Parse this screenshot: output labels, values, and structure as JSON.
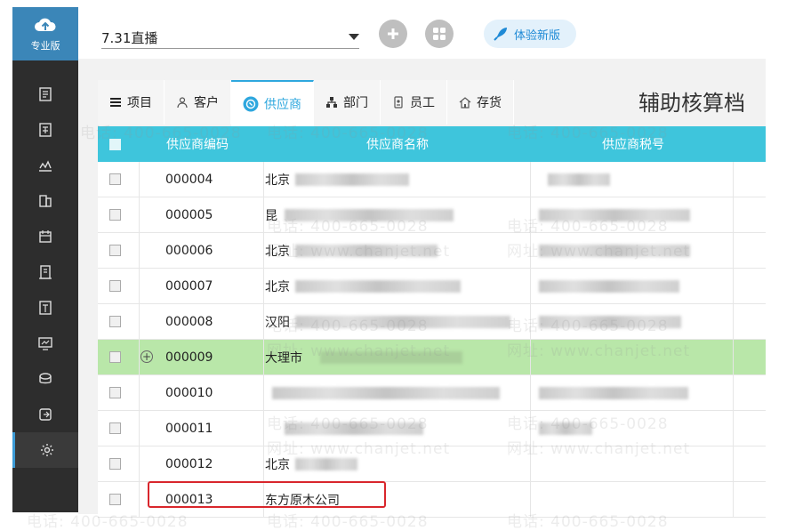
{
  "sidebar": {
    "edition": "专业版",
    "items": [
      {
        "icon": "voucher-icon"
      },
      {
        "icon": "ledger-icon"
      },
      {
        "icon": "chart-line-icon"
      },
      {
        "icon": "report-icon"
      },
      {
        "icon": "calendar-icon"
      },
      {
        "icon": "document-icon"
      },
      {
        "icon": "invoice-icon"
      },
      {
        "icon": "screen-icon"
      },
      {
        "icon": "coins-icon"
      },
      {
        "icon": "export-icon"
      },
      {
        "icon": "gear-icon"
      }
    ]
  },
  "header": {
    "period_value": "7.31直播",
    "new_version_label": "体验新版"
  },
  "tabs": [
    {
      "label": "项目",
      "icon": "list-icon"
    },
    {
      "label": "客户",
      "icon": "user-icon"
    },
    {
      "label": "供应商",
      "icon": "supplier-icon",
      "active": true
    },
    {
      "label": "部门",
      "icon": "org-icon"
    },
    {
      "label": "员工",
      "icon": "badge-icon"
    },
    {
      "label": "存货",
      "icon": "house-icon"
    }
  ],
  "page_title": "辅助核算档",
  "table": {
    "columns": [
      "供应商编码",
      "供应商名称",
      "供应商税号"
    ],
    "rows": [
      {
        "code": "000004",
        "name": "北京"
      },
      {
        "code": "000005",
        "name": "昆"
      },
      {
        "code": "000006",
        "name": "北京"
      },
      {
        "code": "000007",
        "name": "北京"
      },
      {
        "code": "000008",
        "name": "汉阳"
      },
      {
        "code": "000009",
        "name": "大理市"
      },
      {
        "code": "000010",
        "name": ""
      },
      {
        "code": "000011",
        "name": ""
      },
      {
        "code": "000012",
        "name": "北京"
      },
      {
        "code": "000013",
        "name": "东方原木公司"
      }
    ]
  },
  "watermark": {
    "phone": "电话: 400-665-0028",
    "site": "网址: www.chanjet.net"
  },
  "colors": {
    "sidebar_bg": "#2d2d2d",
    "logo_bg": "#3b86b8",
    "header_row": "#3ec5dc",
    "accent": "#2ea7de",
    "highlight_row": "#b9e7a9",
    "annotation_box": "#d9262c"
  }
}
